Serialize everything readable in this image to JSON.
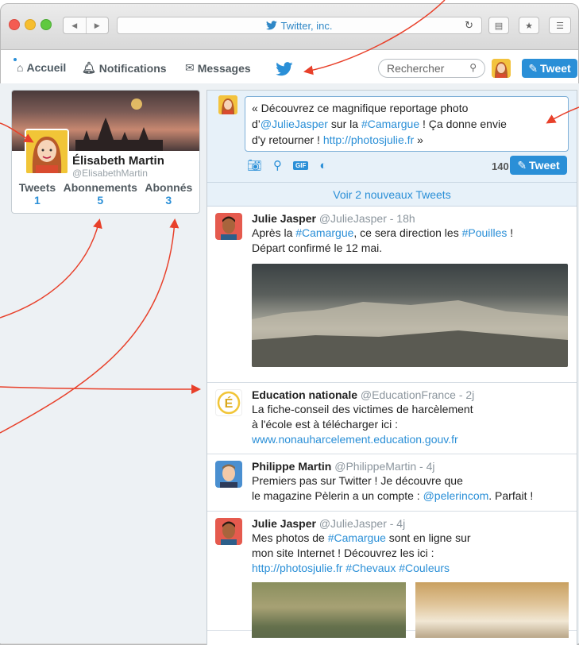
{
  "browser": {
    "address_title": "Twitter, inc."
  },
  "nav": {
    "home": "Accueil",
    "notifications": "Notifications",
    "messages": "Messages",
    "search_placeholder": "Rechercher",
    "tweet_button": "Tweet"
  },
  "profile": {
    "name": "Élisabeth Martin",
    "handle": "@ElisabethMartin",
    "stats": [
      {
        "label": "Tweets",
        "value": "1"
      },
      {
        "label": "Abonnements",
        "value": "5"
      },
      {
        "label": "Abonnés",
        "value": "3"
      }
    ]
  },
  "composer": {
    "text_1": "« Découvrez ce magnifique reportage photo",
    "text_2a": "d’",
    "text_2_mention": "@JulieJasper",
    "text_2b": " sur la ",
    "text_2_hashtag": "#Camargue",
    "text_2c": " ! Ça donne envie",
    "text_3a": "d'y retourner ! ",
    "text_3_link": "http://photosjulie.fr",
    "text_3b": " »",
    "char_count": "140",
    "tweet_button": "Tweet",
    "gif_label": "GIF"
  },
  "new_tweets": "Voir 2 nouveaux Tweets",
  "tweets": [
    {
      "name": "Julie Jasper",
      "meta": " @JulieJasper - 18h",
      "l1a": "Après la ",
      "l1_hashtag": "#Camargue",
      "l1b": ", ce sera direction les ",
      "l1_hashtag2": "#Pouilles",
      "l1c": " !",
      "l2": "Départ confirmé le 12 mai."
    },
    {
      "name": "Education nationale",
      "meta": " @EducationFrance - 2j",
      "l1": "La fiche-conseil des victimes de harcèlement",
      "l2": "à l'école est à télécharger ici :",
      "link": "www.nonauharcelement.education.gouv.fr",
      "logo_letter": "É"
    },
    {
      "name": "Philippe Martin",
      "meta": " @PhilippeMartin - 4j",
      "l1": "Premiers pas sur Twitter ! Je découvre que",
      "l2a": "le magazine Pèlerin a un compte : ",
      "l2_mention": "@pelerincom",
      "l2b": ". Parfait !"
    },
    {
      "name": "Julie Jasper",
      "meta": " @JulieJasper - 4j",
      "l1a": "Mes photos de ",
      "l1_hashtag": "#Camargue",
      "l1b": " sont en ligne sur",
      "l2": "mon site Internet ! Découvrez les ici :",
      "l3_link": "http://photosjulie.fr",
      "l3_h1": " #Chevaux",
      "l3_h2": " #Couleurs"
    }
  ],
  "colors": {
    "accent": "#2a8fd7",
    "annotation": "#e8402a"
  }
}
